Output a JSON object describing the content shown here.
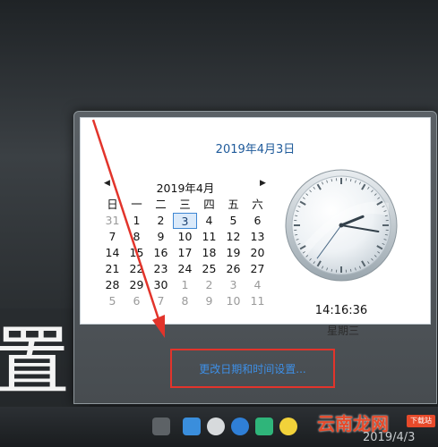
{
  "background": {
    "char": "置"
  },
  "flyout": {
    "date_title": "2019年4月3日",
    "calendar": {
      "prev_symbol": "◀",
      "next_symbol": "▶",
      "month_label": "2019年4月",
      "weekdays": [
        "日",
        "一",
        "二",
        "三",
        "四",
        "五",
        "六"
      ],
      "weeks": [
        [
          "31",
          "1",
          "2",
          "3",
          "4",
          "5",
          "6"
        ],
        [
          "7",
          "8",
          "9",
          "10",
          "11",
          "12",
          "13"
        ],
        [
          "14",
          "15",
          "16",
          "17",
          "18",
          "19",
          "20"
        ],
        [
          "21",
          "22",
          "23",
          "24",
          "25",
          "26",
          "27"
        ],
        [
          "28",
          "29",
          "30",
          "1",
          "2",
          "3",
          "4"
        ],
        [
          "5",
          "6",
          "7",
          "8",
          "9",
          "10",
          "11"
        ]
      ],
      "selected_day": "3"
    },
    "clock": {
      "hours": 14,
      "minutes": 16,
      "seconds": 36
    },
    "time_text": "14:16:36",
    "weekday_text": "星期三",
    "change_link": "更改日期和时间设置..."
  },
  "taskbar": {
    "icons": [
      "keyboard-icon",
      "app-icon-blue",
      "app-icon-gear",
      "app-icon-shield",
      "app-icon-video",
      "app-icon-green-plus"
    ],
    "partial_text": "2019/4/3"
  },
  "watermark": {
    "text": "云南龙网",
    "badge": "下载站"
  },
  "colors": {
    "accent": "#1e5a9a",
    "link": "#3e8fe6",
    "highlight_box": "#e2342b"
  }
}
